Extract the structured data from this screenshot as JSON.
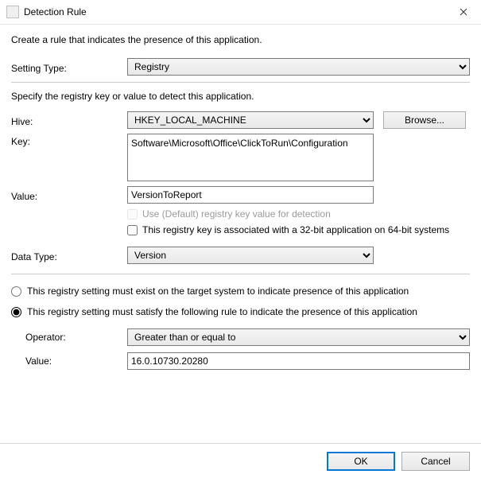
{
  "window": {
    "title": "Detection Rule"
  },
  "intro": "Create a rule that indicates the presence of this application.",
  "settingType": {
    "label": "Setting Type:",
    "value": "Registry"
  },
  "sub": "Specify the registry key or value to detect this application.",
  "hive": {
    "label": "Hive:",
    "value": "HKEY_LOCAL_MACHINE",
    "browse": "Browse..."
  },
  "key": {
    "label": "Key:",
    "value": "Software\\Microsoft\\Office\\ClickToRun\\Configuration"
  },
  "value": {
    "label": "Value:",
    "value": "VersionToReport"
  },
  "useDefault": {
    "label": "Use (Default) registry key value for detection",
    "checked": false
  },
  "is32bit": {
    "label": "This registry key is associated with a 32-bit application on 64-bit systems",
    "checked": false
  },
  "dataType": {
    "label": "Data Type:",
    "value": "Version"
  },
  "radio": {
    "exist": "This registry setting must exist on the target system to indicate presence of this application",
    "satisfy": "This registry setting must satisfy the following rule to indicate the presence of this application",
    "selected": "satisfy"
  },
  "operator": {
    "label": "Operator:",
    "value": "Greater than or equal to"
  },
  "ruleValue": {
    "label": "Value:",
    "value": "16.0.10730.20280"
  },
  "buttons": {
    "ok": "OK",
    "cancel": "Cancel"
  }
}
